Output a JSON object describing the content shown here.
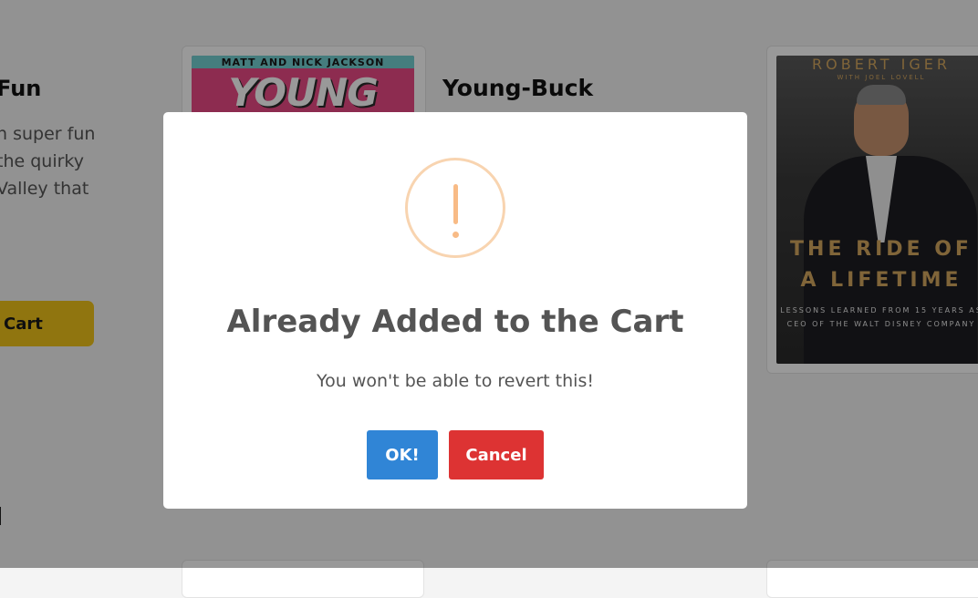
{
  "background": {
    "left_book": {
      "title": "Fun",
      "description": "n super fun the quirky Valley that",
      "add_button": "Cart"
    },
    "mid_book": {
      "cover_authors": "MATT AND NICK JACKSON",
      "cover_title": "YOUNG BUCKS",
      "title": "Young-Buck"
    },
    "right_book": {
      "cover_author": "ROBERT IGER",
      "cover_with": "WITH JOEL LOVELL",
      "cover_title_line1": "THE RIDE OF",
      "cover_title_line2": "A LIFETIME",
      "cover_subtitle": "LESSONS LEARNED FROM 15 YEARS AS CEO OF THE WALT DISNEY COMPANY"
    }
  },
  "dialog": {
    "icon": "warning-icon",
    "icon_color": "#f8bb86",
    "title": "Already Added to the Cart",
    "text": "You won't be able to revert this!",
    "confirm_label": "OK!",
    "confirm_color": "#3085d6",
    "cancel_label": "Cancel",
    "cancel_color": "#dd3333"
  }
}
